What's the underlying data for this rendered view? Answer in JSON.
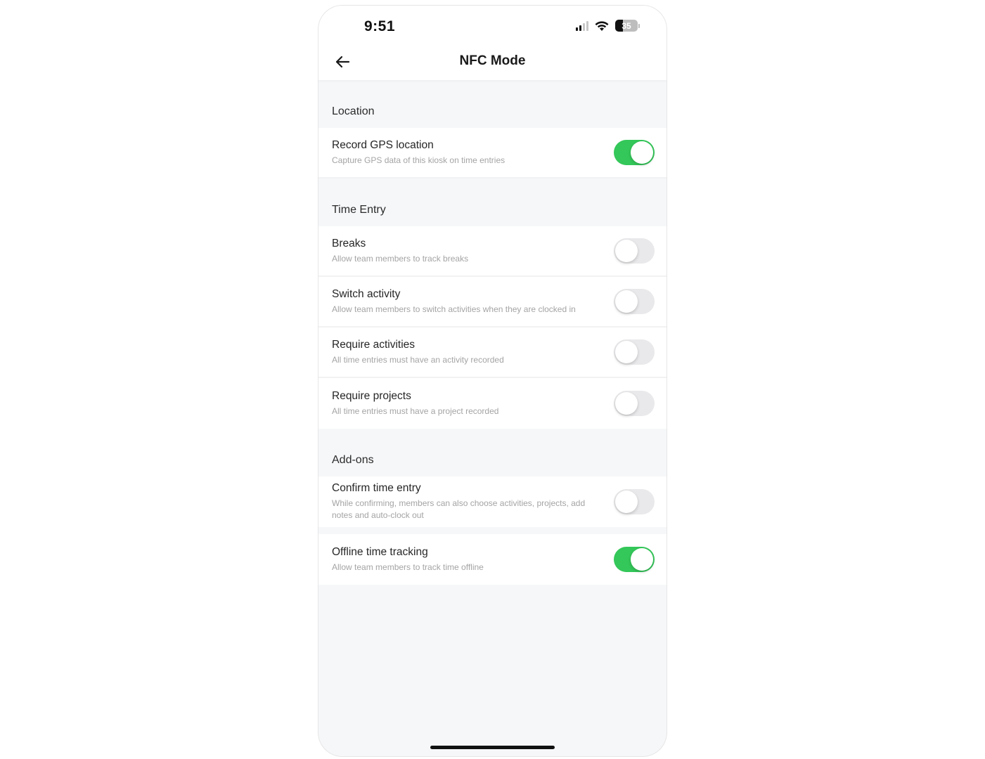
{
  "status_bar": {
    "time": "9:51",
    "battery_percent": "35",
    "signal_bars_active": 2,
    "signal_bars_total": 4,
    "icons": [
      "cellular-signal-icon",
      "wifi-icon",
      "battery-icon"
    ]
  },
  "header": {
    "title": "NFC Mode",
    "back_icon": "arrow-left-icon"
  },
  "sections": [
    {
      "title": "Location",
      "items": [
        {
          "title": "Record GPS location",
          "subtitle": "Capture GPS data of this kiosk on time entries",
          "enabled": true
        }
      ]
    },
    {
      "title": "Time Entry",
      "items": [
        {
          "title": "Breaks",
          "subtitle": "Allow team members to track breaks",
          "enabled": false
        },
        {
          "title": "Switch activity",
          "subtitle": "Allow team members to switch activities when they are clocked in",
          "enabled": false
        },
        {
          "title": "Require activities",
          "subtitle": "All time entries must have an activity recorded",
          "enabled": false
        },
        {
          "title": "Require projects",
          "subtitle": "All time entries must have a project recorded",
          "enabled": false
        }
      ]
    },
    {
      "title": "Add-ons",
      "items": [
        {
          "title": "Confirm time entry",
          "subtitle": "While confirming, members can also choose activities, projects, add notes and auto-clock out",
          "enabled": false
        },
        {
          "title": "Offline time tracking",
          "subtitle": "Allow team members to track time offline",
          "enabled": true
        }
      ]
    }
  ],
  "colors": {
    "toggle_on": "#34c759",
    "toggle_off": "#e9e9eb",
    "background": "#f6f7f9"
  }
}
